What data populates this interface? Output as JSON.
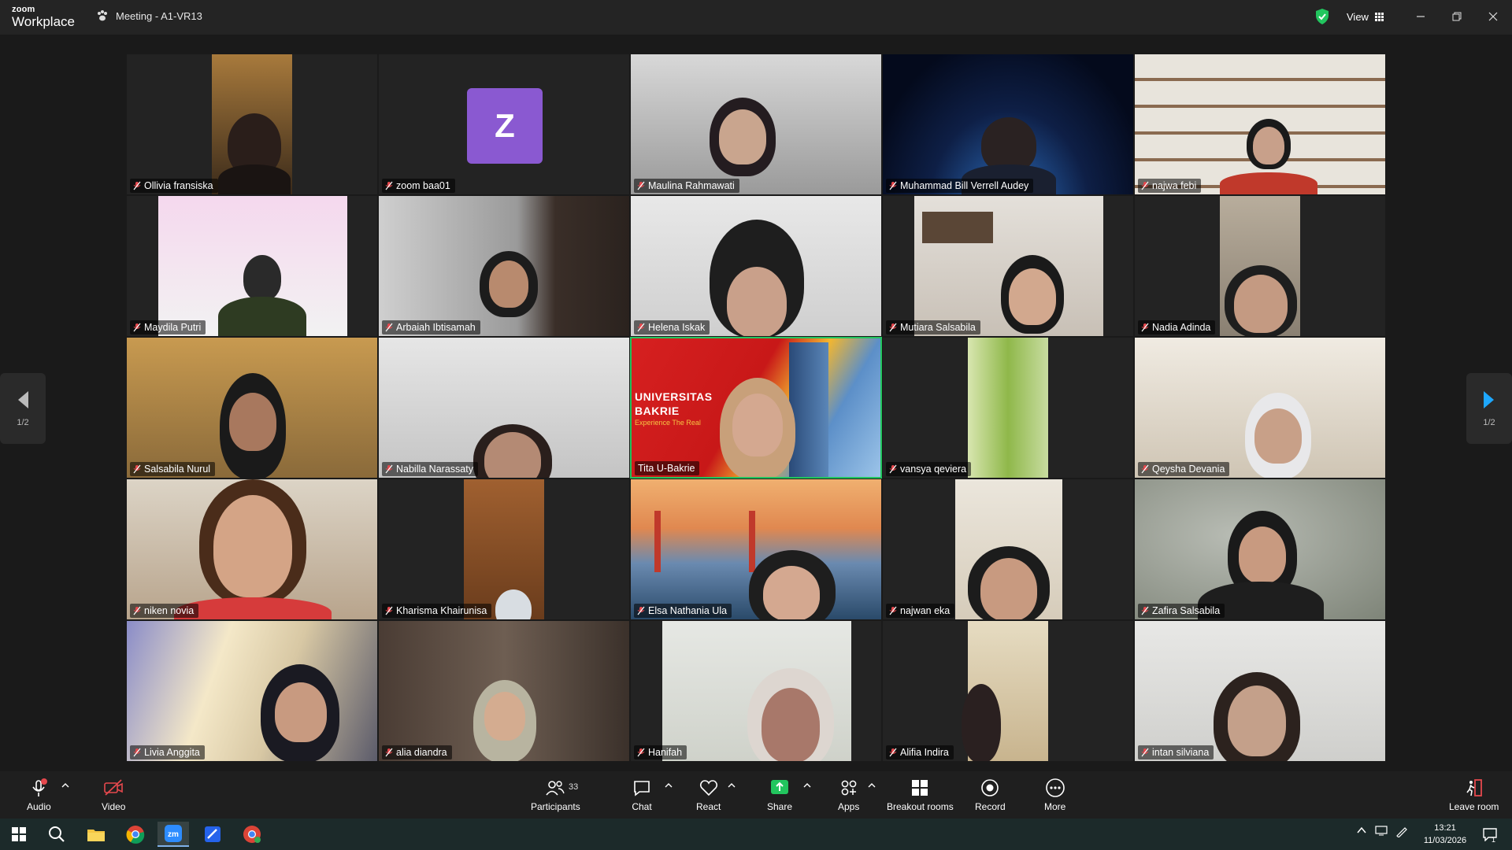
{
  "titlebar": {
    "logo_top": "zoom",
    "logo_bottom": "Workplace",
    "meeting_title": "Meeting - A1-VR13",
    "view_label": "View",
    "accent_color": "#22c55e"
  },
  "pager": {
    "left_label": "1/2",
    "right_label": "1/2",
    "accent_color": "#1ea7fd"
  },
  "participants": [
    {
      "name": "Ollivia fransiska"
    },
    {
      "name": "zoom baa01",
      "avatar_letter": "Z"
    },
    {
      "name": "Maulina Rahmawati"
    },
    {
      "name": "Muhammad Bill Verrell Audey"
    },
    {
      "name": "najwa febi"
    },
    {
      "name": "Maydila Putri"
    },
    {
      "name": "Arbaiah Ibtisamah"
    },
    {
      "name": "Helena Iskak"
    },
    {
      "name": "Mutiara Salsabila"
    },
    {
      "name": "Nadia Adinda"
    },
    {
      "name": "Salsabila Nurul"
    },
    {
      "name": "Nabilla Narassaty"
    },
    {
      "name": "Tita U-Bakrie",
      "active": true,
      "bg_text_1": "UNIVERSITAS",
      "bg_text_2": "BAKRIE",
      "bg_text_3": "Experience The Real"
    },
    {
      "name": "vansya qeviera"
    },
    {
      "name": "Qeysha Devania"
    },
    {
      "name": "niken novia"
    },
    {
      "name": "Kharisma Khairunisa"
    },
    {
      "name": "Elsa Nathania Ula"
    },
    {
      "name": "najwan eka"
    },
    {
      "name": "Zafira Salsabila"
    },
    {
      "name": "Livia Anggita"
    },
    {
      "name": "alia diandra"
    },
    {
      "name": "Hanifah"
    },
    {
      "name": "Alifia Indira"
    },
    {
      "name": "intan silviana"
    }
  ],
  "toolbar": {
    "audio": "Audio",
    "video": "Video",
    "participants": "Participants",
    "participants_count": "33",
    "chat": "Chat",
    "react": "React",
    "share": "Share",
    "apps": "Apps",
    "breakout": "Breakout rooms",
    "record": "Record",
    "more": "More",
    "leave": "Leave room",
    "share_color": "#22c55e",
    "muted_color": "#e5484d"
  },
  "taskbar": {
    "time": "13:21",
    "date": "11/03/2026",
    "notification_count": "1"
  }
}
